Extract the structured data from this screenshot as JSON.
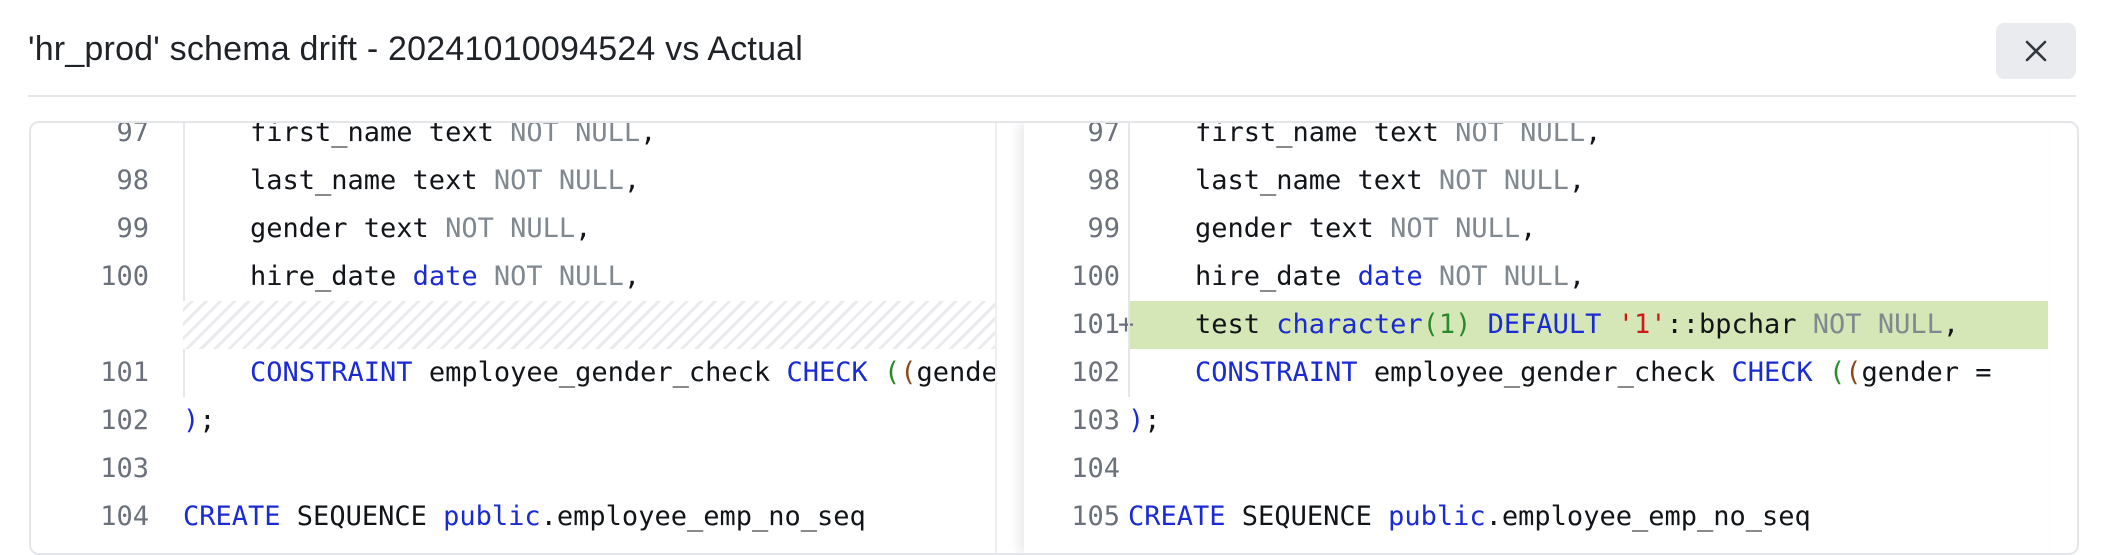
{
  "header": {
    "title": "'hr_prod' schema drift - 20241010094524 vs Actual",
    "close_icon": "close-icon"
  },
  "colors": {
    "keyword": "#1a2ad4",
    "muted_keyword": "#808890",
    "number": "#2a8a2a",
    "string": "#d01818",
    "added_line_bg": "#d5e6b7"
  },
  "left": {
    "lines": [
      {
        "num": "97",
        "indent": true,
        "tokens": [
          {
            "t": "first_name text ",
            "c": "plain"
          },
          {
            "t": "NOT NULL",
            "c": "mute"
          },
          {
            "t": ",",
            "c": "plain"
          }
        ]
      },
      {
        "num": "98",
        "indent": true,
        "tokens": [
          {
            "t": "last_name text ",
            "c": "plain"
          },
          {
            "t": "NOT NULL",
            "c": "mute"
          },
          {
            "t": ",",
            "c": "plain"
          }
        ]
      },
      {
        "num": "99",
        "indent": true,
        "tokens": [
          {
            "t": "gender text ",
            "c": "plain"
          },
          {
            "t": "NOT NULL",
            "c": "mute"
          },
          {
            "t": ",",
            "c": "plain"
          }
        ]
      },
      {
        "num": "100",
        "indent": true,
        "tokens": [
          {
            "t": "hire_date ",
            "c": "plain"
          },
          {
            "t": "date",
            "c": "kw"
          },
          {
            "t": " ",
            "c": "plain"
          },
          {
            "t": "NOT NULL",
            "c": "mute"
          },
          {
            "t": ",",
            "c": "plain"
          }
        ]
      },
      {
        "num": "",
        "placeholder": true,
        "tokens": []
      },
      {
        "num": "101",
        "indent": true,
        "tokens": [
          {
            "t": "CONSTRAINT",
            "c": "kw"
          },
          {
            "t": " employee_gender_check ",
            "c": "plain"
          },
          {
            "t": "CHECK",
            "c": "kw"
          },
          {
            "t": " ",
            "c": "plain"
          },
          {
            "t": "(",
            "c": "num"
          },
          {
            "t": "(",
            "c": "brk"
          },
          {
            "t": "gender",
            "c": "plain"
          }
        ]
      },
      {
        "num": "102",
        "indent": false,
        "tokens": [
          {
            "t": ")",
            "c": "kw"
          },
          {
            "t": ";",
            "c": "plain"
          }
        ]
      },
      {
        "num": "103",
        "indent": false,
        "tokens": []
      },
      {
        "num": "104",
        "indent": false,
        "tokens": [
          {
            "t": "CREATE",
            "c": "kw"
          },
          {
            "t": " SEQUENCE ",
            "c": "plain"
          },
          {
            "t": "public",
            "c": "kw"
          },
          {
            "t": ".employee_emp_no_seq",
            "c": "plain"
          }
        ]
      }
    ]
  },
  "right": {
    "lines": [
      {
        "num": "97",
        "indent": true,
        "tokens": [
          {
            "t": "first_name text ",
            "c": "plain"
          },
          {
            "t": "NOT NULL",
            "c": "mute"
          },
          {
            "t": ",",
            "c": "plain"
          }
        ]
      },
      {
        "num": "98",
        "indent": true,
        "tokens": [
          {
            "t": "last_name text ",
            "c": "plain"
          },
          {
            "t": "NOT NULL",
            "c": "mute"
          },
          {
            "t": ",",
            "c": "plain"
          }
        ]
      },
      {
        "num": "99",
        "indent": true,
        "tokens": [
          {
            "t": "gender text ",
            "c": "plain"
          },
          {
            "t": "NOT NULL",
            "c": "mute"
          },
          {
            "t": ",",
            "c": "plain"
          }
        ]
      },
      {
        "num": "100",
        "indent": true,
        "tokens": [
          {
            "t": "hire_date ",
            "c": "plain"
          },
          {
            "t": "date",
            "c": "kw"
          },
          {
            "t": " ",
            "c": "plain"
          },
          {
            "t": "NOT NULL",
            "c": "mute"
          },
          {
            "t": ",",
            "c": "plain"
          }
        ]
      },
      {
        "num": "101",
        "indent": true,
        "added": true,
        "marker": "+",
        "tokens": [
          {
            "t": "test ",
            "c": "plain"
          },
          {
            "t": "character",
            "c": "kw"
          },
          {
            "t": "(1)",
            "c": "num"
          },
          {
            "t": " ",
            "c": "plain"
          },
          {
            "t": "DEFAULT",
            "c": "kw"
          },
          {
            "t": " ",
            "c": "plain"
          },
          {
            "t": "'1'",
            "c": "str"
          },
          {
            "t": "::bpchar ",
            "c": "plain"
          },
          {
            "t": "NOT NULL",
            "c": "mute"
          },
          {
            "t": ",",
            "c": "plain"
          }
        ]
      },
      {
        "num": "102",
        "indent": true,
        "tokens": [
          {
            "t": "CONSTRAINT",
            "c": "kw"
          },
          {
            "t": " employee_gender_check ",
            "c": "plain"
          },
          {
            "t": "CHECK",
            "c": "kw"
          },
          {
            "t": " ",
            "c": "plain"
          },
          {
            "t": "(",
            "c": "num"
          },
          {
            "t": "(",
            "c": "brk"
          },
          {
            "t": "gender =",
            "c": "plain"
          }
        ]
      },
      {
        "num": "103",
        "indent": false,
        "tokens": [
          {
            "t": ")",
            "c": "kw"
          },
          {
            "t": ";",
            "c": "plain"
          }
        ]
      },
      {
        "num": "104",
        "indent": false,
        "tokens": []
      },
      {
        "num": "105",
        "indent": false,
        "tokens": [
          {
            "t": "CREATE",
            "c": "kw"
          },
          {
            "t": " SEQUENCE ",
            "c": "plain"
          },
          {
            "t": "public",
            "c": "kw"
          },
          {
            "t": ".employee_emp_no_seq",
            "c": "plain"
          }
        ]
      }
    ]
  }
}
